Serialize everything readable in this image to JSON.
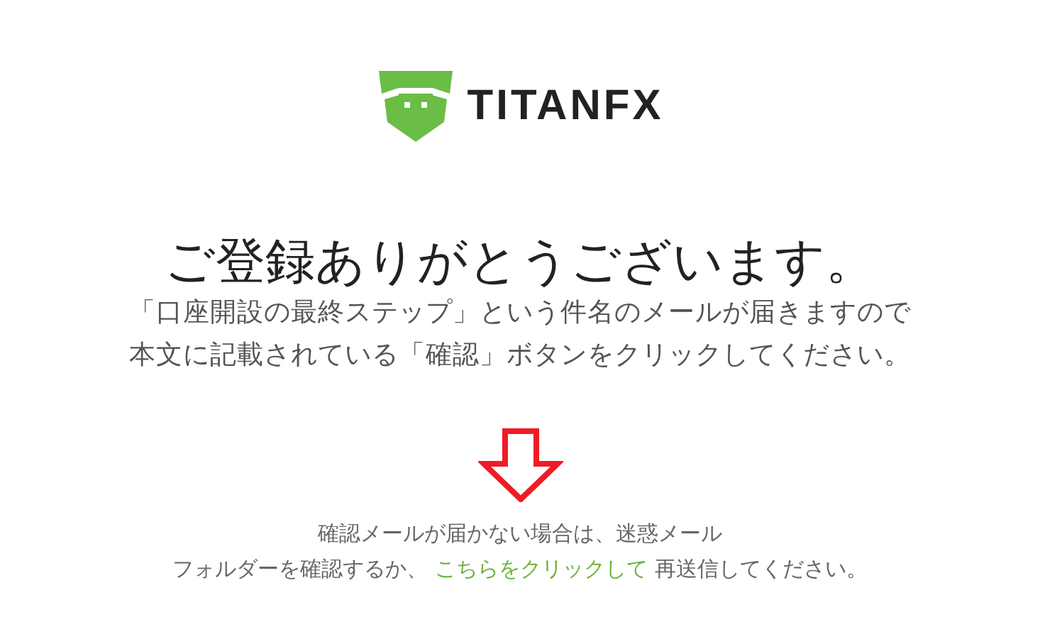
{
  "logo": {
    "text": "TITANFX"
  },
  "heading": "ご登録ありがとうございます。",
  "message_lines": [
    "「口座開設の最終ステップ」という件名のメールが届きますので",
    "本文に記載されている「確認」ボタンをクリックしてください。"
  ],
  "notice": {
    "line_1": "確認メールが届かない場合は、迷惑メール",
    "before_link": "フォルダーを確認するか、",
    "link": "こちらをクリックして",
    "after_link": "再送信してください。"
  }
}
